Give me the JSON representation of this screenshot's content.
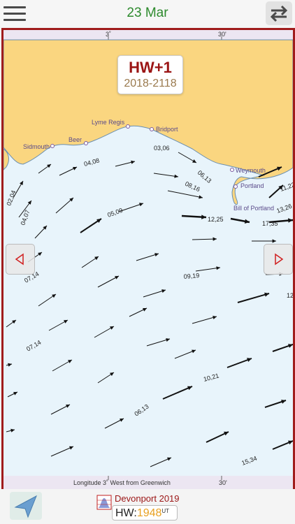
{
  "header": {
    "date": "23 Mar"
  },
  "icons": {
    "menu": "hamburger-menu-icon",
    "swap": "swap-arrows-icon",
    "locate": "location-arrow-icon",
    "tide": "tide-curve-icon",
    "prev": "triangle-left-icon",
    "next": "triangle-right-icon"
  },
  "colors": {
    "frame": "#a01c1c",
    "land": "#fad680",
    "sea": "#e8f4fb",
    "date": "#2d8a2d",
    "hw_label": "#9b1515",
    "hw_time": "#e8a020"
  },
  "map": {
    "title": "HW+1",
    "time_range": "2018-2118",
    "scale_top": [
      "3˚",
      "30'"
    ],
    "scale_bottom": {
      "label": "Longitude  3˚ West from Greenwich",
      "minute": "30'"
    },
    "places": [
      "Lyme Regis",
      "Bridport",
      "Beer",
      "Sidmouth",
      "Weymouth",
      "Portland",
      "Bill of Portland"
    ],
    "rates": [
      "03,06",
      "04,08",
      "06,13",
      "08,16",
      "02,04",
      "04,07",
      "05,09",
      "12,25",
      "17,35",
      "11,22",
      "13,26",
      "07,14",
      "09,19",
      "12",
      "07,14",
      "10,21",
      "06,13",
      "15,34"
    ]
  },
  "footer": {
    "port": "Devonport 2019",
    "hw_prefix": "HW:",
    "hw_time": "1948",
    "hw_unit": "UT"
  }
}
